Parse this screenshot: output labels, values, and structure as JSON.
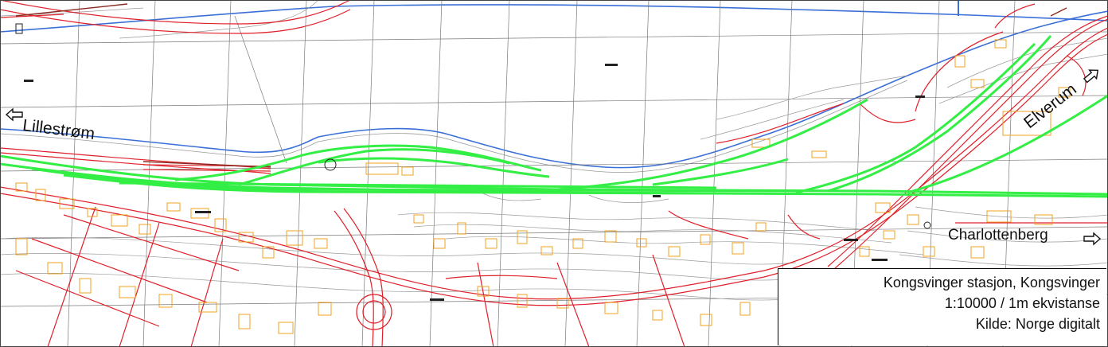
{
  "map": {
    "labels": {
      "lillestrom": "Lillestrøm",
      "elverum": "Elverum",
      "charlottenberg": "Charlottenberg"
    },
    "info_box": {
      "title": "Kongsvinger stasjon, Kongsvinger",
      "scale": "1:10000 / 1m ekvistanse",
      "source": "Kilde: Norge digitalt"
    },
    "colors": {
      "proposed_track": "#33ee44",
      "roads": "#e0202a",
      "buildings": "#f0a020",
      "river_shore": "#3a6fd8",
      "contours": "#9a9a9a",
      "grid": "#7a7a7a"
    },
    "icons": {
      "direction_arrow": "arrow-outline-icon"
    }
  }
}
